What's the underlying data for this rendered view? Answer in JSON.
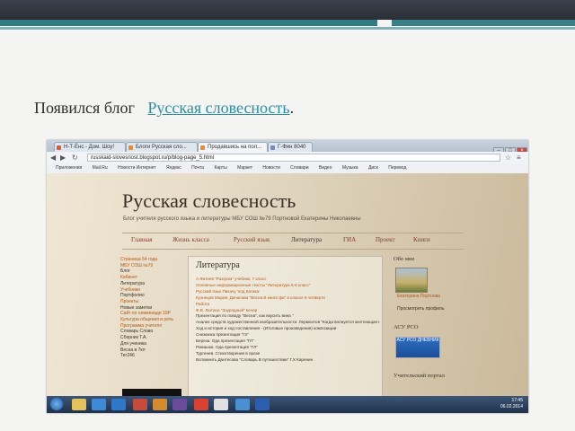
{
  "slide": {
    "heading_prefix": "Появился блог",
    "heading_link": "Русская словесность",
    "heading_suffix": ".",
    "colors": {
      "top_bar": "#2b2f37",
      "accent": "#2f7d83",
      "link": "#2a8fa3"
    }
  },
  "browser": {
    "tabs": [
      "Н-Т-Ёнс - Дом. Шоу!",
      "Блоги Русская сло...",
      "Продавшись на пол...",
      "Г-Фин 8040"
    ],
    "url": "russkaid-slovesnost.blogspot.ru/p/blog-page_5.html",
    "bookmarks": [
      "Приложения",
      "Mail.Ru",
      "Новости Интернет",
      "Яндекс",
      "Почта",
      "Карты",
      "Маркет",
      "Новости",
      "Словари",
      "Видео",
      "Музыка",
      "Диск",
      "Перевод"
    ]
  },
  "blog": {
    "title": "Русская словесность",
    "subtitle": "Блог учителя русского языка и литературы МБУ СОШ №79 Портновой Екатерины Николаевны",
    "menu": [
      "Главная",
      "Жизнь класса",
      "Русский язык",
      "Литература",
      "ГИА",
      "Проект",
      "Книги"
    ],
    "current_menu": "Литература",
    "post_title": "Литература",
    "post_lines": [
      "А.Фатеев \"Разгром\" учебник, 7 класс",
      "Основные информационные тексты \"Литература 5-6 класс\"",
      "Русский язык Пикачу 'под Катика'",
      "Кузнецов Мария. Денисова \"Весна В книге фи\" в классе 6 четверти",
      "Работа",
      "Ф.В. Лютина \"Заурядный\" вечер",
      "Презентация по поводу \"Весна\", как вкусить вина \"",
      "Анализ средств художественной изобразительности. Лермонтов \"Когда волнуется желтеющая нива..\"",
      "Ход и история и ход составления - (Итоговые произведения) композиции",
      "Снежинка презентация \"Гл\"",
      "Береза. Ода презентация \"ГЛ\"",
      "Ромашка. Ода презентация \"ГЛ\"",
      "Тургенев. Стихотворения в прозе",
      "Вспомнить Дантесова \"Словарь В путешествии\" Г.Х Каренин"
    ],
    "left_links": [
      "Страница 54 года",
      "МБУ СОШ №79",
      "Блог",
      "Кабинет",
      "Литература",
      "Учебники",
      "Портфолио",
      "Проекты",
      "Новые заметки",
      "Сайт по олимпиаде 10Р",
      "Культура общения и речь",
      "Программа учителя",
      "Словарь Слово",
      "Сборник Т.А.",
      "Для ученика",
      "Весна в 7кл",
      "Тег246"
    ],
    "right_sidebar": {
      "about_heading": "Обо мне",
      "author_name": "Екатерина Портнова",
      "profile_link": "Просмотреть профиль",
      "aso_heading": "АСУ РСО",
      "aso_badge": "АСУ РСО ДНЕВНИК",
      "journal_heading": "Учительский портал"
    }
  },
  "taskbar": {
    "time": "17:45",
    "date": "06.02.2014"
  }
}
